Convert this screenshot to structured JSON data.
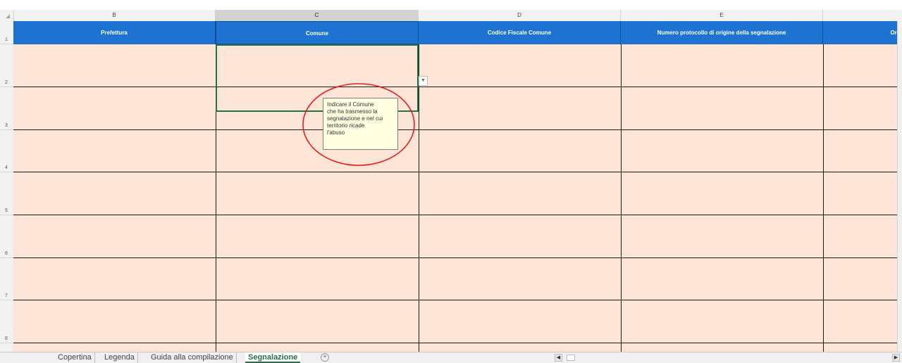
{
  "sheet": {
    "column_letters": [
      "B",
      "C",
      "D",
      "E"
    ],
    "row_numbers": [
      "1",
      "2",
      "3",
      "4",
      "5",
      "6",
      "7",
      "8"
    ],
    "headers": [
      "Prefettura",
      "Comune",
      "Codice Fiscale Comune",
      "Numero protocollo di origine della segnalazione",
      "Ori"
    ],
    "selected_cell": "C2",
    "cell_fill_color": "#fce4d6",
    "header_fill_color": "#1e73d2",
    "dropdown_icon": "dropdown-arrow-icon"
  },
  "tooltip": {
    "text": "Indicare il Comune\nche ha trasmesso la\nsegnalazione e nel cui\nterritorio ricade\nl'abuso",
    "annotation_color": "#e02020"
  },
  "tabs": {
    "items": [
      "Copertina",
      "Legenda",
      "Guida alla compilazione",
      "Segnalazione"
    ],
    "active": "Segnalazione",
    "add_icon": "plus-icon"
  }
}
